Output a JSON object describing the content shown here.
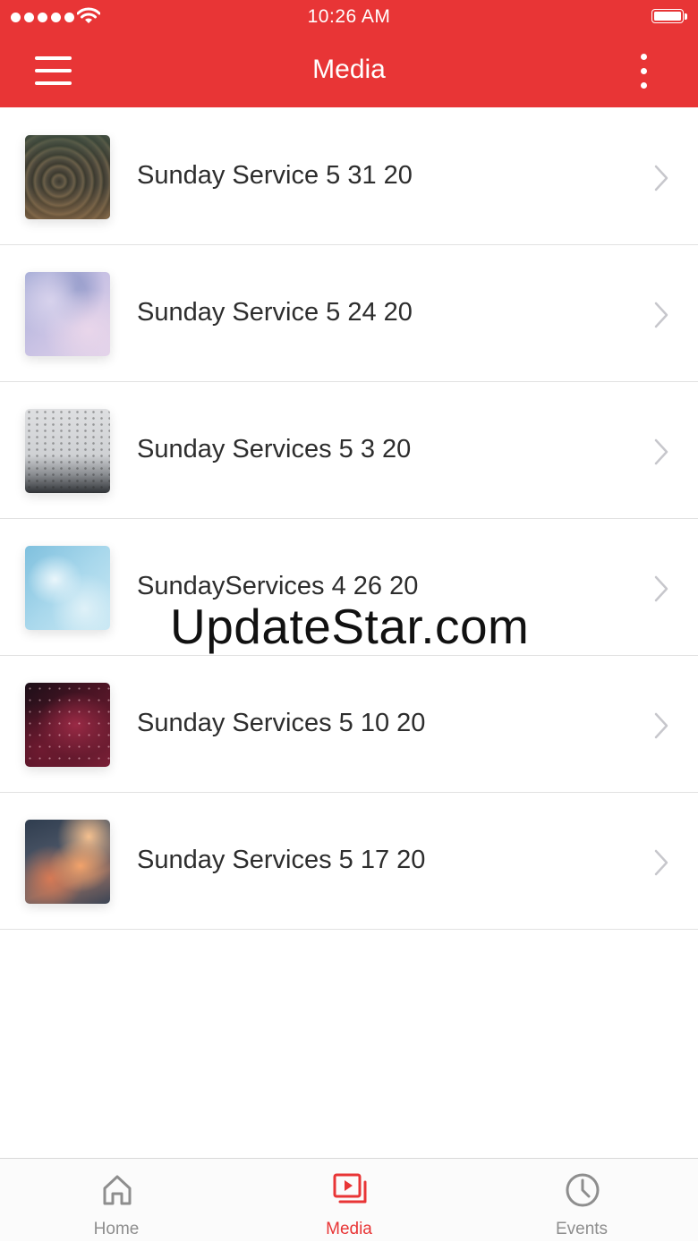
{
  "status_bar": {
    "time": "10:26 AM"
  },
  "header": {
    "title": "Media",
    "background_color": "#e83536",
    "menu_icon": "hamburger-menu-icon",
    "more_icon": "more-vertical-icon"
  },
  "media_list": {
    "items": [
      {
        "title": "Sunday Service 5 31 20",
        "thumbnail": "wood-rings-texture"
      },
      {
        "title": "Sunday Service 5 24 20",
        "thumbnail": "lavender-clouds-sky"
      },
      {
        "title": "Sunday Services 5 3 20",
        "thumbnail": "birds-over-misty-sky"
      },
      {
        "title": "SundayServices 4 26 20",
        "thumbnail": "blue-sky-clouds"
      },
      {
        "title": "Sunday Services 5 10 20",
        "thumbnail": "red-night-sky"
      },
      {
        "title": "Sunday Services 5 17 20",
        "thumbnail": "sunset-clouds"
      }
    ]
  },
  "watermark": "UpdateStar.com",
  "tab_bar": {
    "active_color": "#e83536",
    "inactive_color": "#8e8e8e",
    "tabs": [
      {
        "label": "Home",
        "icon": "home-icon",
        "active": false
      },
      {
        "label": "Media",
        "icon": "media-play-icon",
        "active": true
      },
      {
        "label": "Events",
        "icon": "clock-icon",
        "active": false
      }
    ]
  }
}
